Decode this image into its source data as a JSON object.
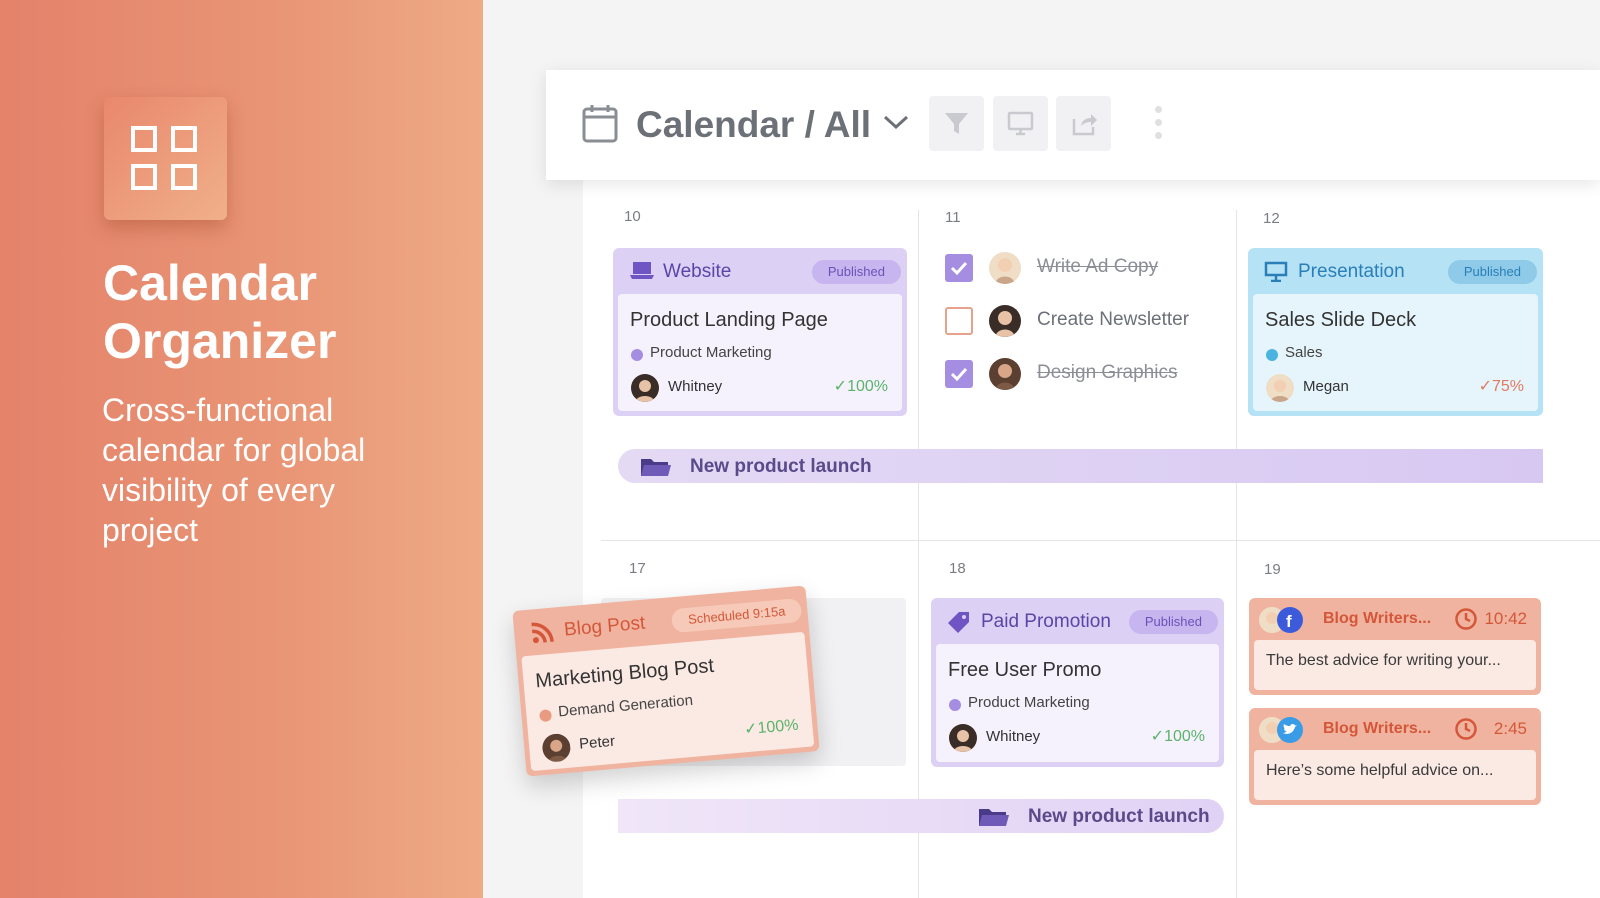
{
  "promo": {
    "title_line1": "Calendar",
    "title_line2": "Organizer",
    "subtitle": "Cross-functional calendar for global visibility of every project"
  },
  "toolbar": {
    "title": "Calendar / All",
    "icons": [
      "calendar-icon",
      "chevron-down-icon",
      "filter-icon",
      "monitor-icon",
      "share-icon",
      "more-vertical-icon"
    ]
  },
  "days": {
    "d10": "10",
    "d11": "11",
    "d12": "12",
    "d17": "17",
    "d18": "18",
    "d19": "19"
  },
  "cards": {
    "website": {
      "type": "Website",
      "badge": "Published",
      "title": "Product Landing Page",
      "team": "Product Marketing",
      "person": "Whitney",
      "progress": "100%"
    },
    "presentation": {
      "type": "Presentation",
      "badge": "Published",
      "title": "Sales Slide Deck",
      "team": "Sales",
      "person": "Megan",
      "progress": "75%"
    },
    "blog": {
      "type": "Blog Post",
      "badge": "Scheduled 9:15a",
      "title": "Marketing Blog Post",
      "team": "Demand Generation",
      "person": "Peter",
      "progress": "100%"
    },
    "paid": {
      "type": "Paid Promotion",
      "badge": "Published",
      "title": "Free User Promo",
      "team": "Product Marketing",
      "person": "Whitney",
      "progress": "100%"
    }
  },
  "tasks": [
    {
      "label": "Write Ad Copy",
      "done": true
    },
    {
      "label": "Create Newsletter",
      "done": false
    },
    {
      "label": "Design Graphics",
      "done": true
    }
  ],
  "projects": {
    "bar1": "New product launch",
    "bar2": "New product launch"
  },
  "social": [
    {
      "name": "Blog Writers...",
      "network": "facebook",
      "time": "10:42",
      "text": "The best advice for writing your..."
    },
    {
      "name": "Blog Writers...",
      "network": "twitter",
      "time": "2:45",
      "text": "Here’s some helpful advice on..."
    }
  ],
  "colors": {
    "accent_orange": "#e4826a",
    "purple": "#8b6cd6",
    "blue": "#4ab3e0",
    "coral": "#d4573a",
    "green": "#5ab36a"
  }
}
